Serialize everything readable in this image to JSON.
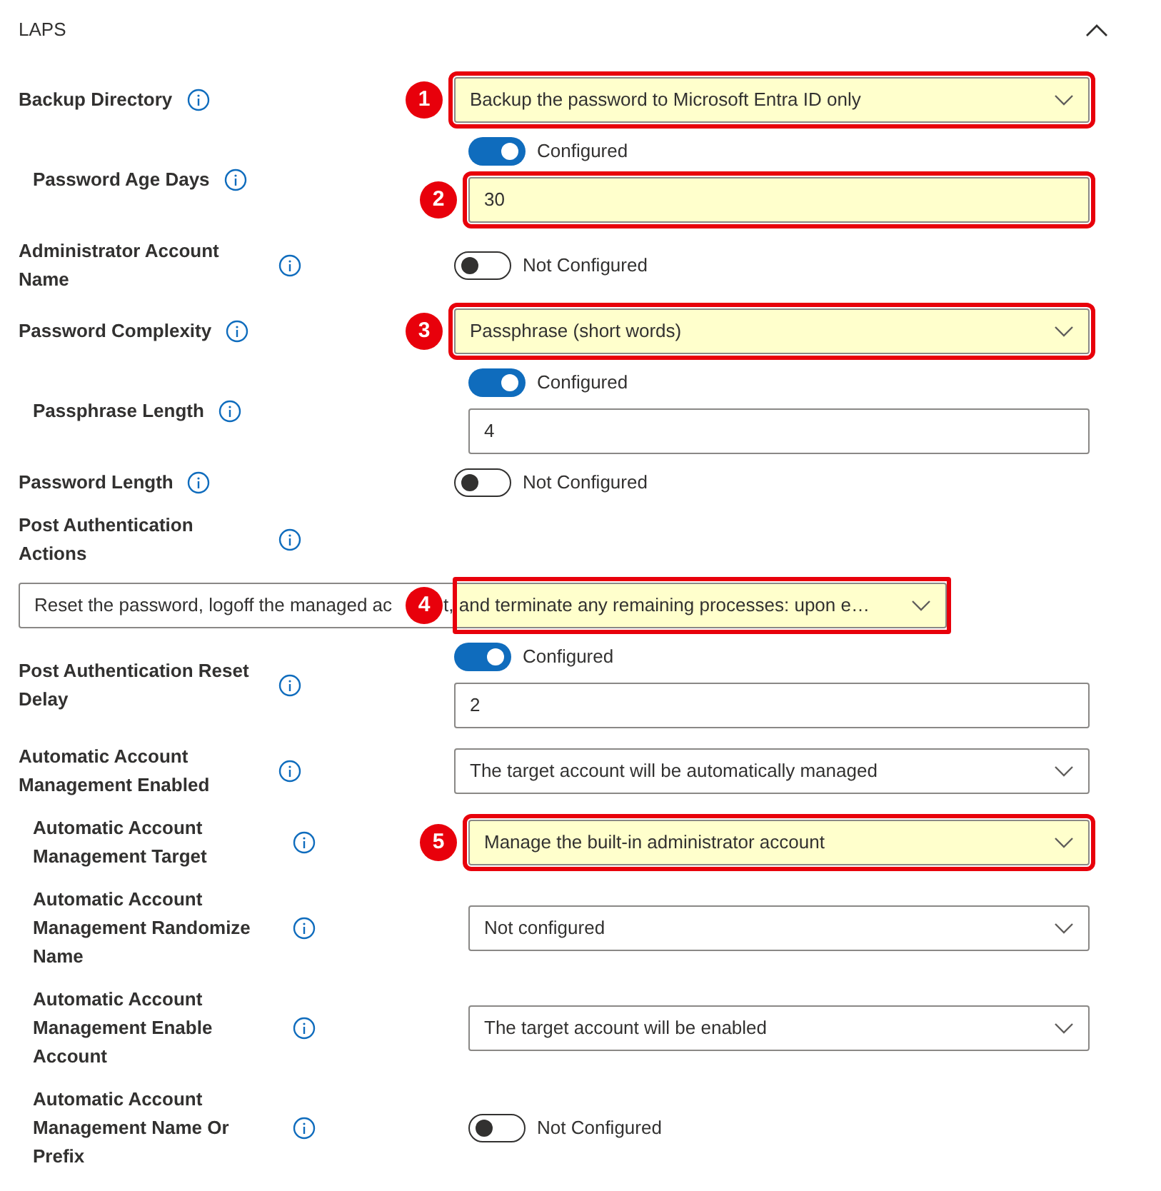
{
  "section": {
    "title": "LAPS",
    "expanded": true
  },
  "settings": [
    {
      "label": "Backup Directory",
      "controls": [
        {
          "kind": "dropdown",
          "value": "Backup the password to Microsoft Entra ID only",
          "callout": "1"
        }
      ],
      "children": [
        {
          "label": "Password Age Days",
          "controls": [
            {
              "kind": "toggle",
              "on": true,
              "text": "Configured"
            },
            {
              "kind": "textbox",
              "value": "30",
              "callout": "2"
            }
          ]
        }
      ]
    },
    {
      "label": "Administrator Account Name",
      "controls": [
        {
          "kind": "toggle",
          "on": false,
          "text": "Not Configured"
        }
      ]
    },
    {
      "label": "Password Complexity",
      "controls": [
        {
          "kind": "dropdown",
          "value": "Passphrase (short words)",
          "callout": "3"
        }
      ],
      "children": [
        {
          "label": "Passphrase Length",
          "controls": [
            {
              "kind": "toggle",
              "on": true,
              "text": "Configured"
            },
            {
              "kind": "textbox",
              "value": "4"
            }
          ]
        }
      ]
    },
    {
      "label": "Password Length",
      "controls": [
        {
          "kind": "toggle",
          "on": false,
          "text": "Not Configured"
        }
      ]
    },
    {
      "label": "Post Authentication Actions",
      "controls": [
        {
          "kind": "wide_dropdown",
          "value_parts": [
            "Reset the password, logoff the managed ac",
            "t, and terminate any remaining processes: upon e…"
          ],
          "callout": "4"
        }
      ]
    },
    {
      "label": "Post Authentication Reset Delay",
      "controls": [
        {
          "kind": "toggle",
          "on": true,
          "text": "Configured"
        },
        {
          "kind": "textbox",
          "value": "2"
        }
      ]
    },
    {
      "label": "Automatic Account Management Enabled",
      "controls": [
        {
          "kind": "dropdown",
          "value": "The target account will be automatically managed"
        }
      ],
      "children": [
        {
          "label": "Automatic Account Management Target",
          "controls": [
            {
              "kind": "dropdown",
              "value": "Manage the built-in administrator account",
              "callout": "5"
            }
          ]
        },
        {
          "label": "Automatic Account Management Randomize Name",
          "controls": [
            {
              "kind": "dropdown",
              "value": "Not configured"
            }
          ]
        },
        {
          "label": "Automatic Account Management Enable Account",
          "controls": [
            {
              "kind": "dropdown",
              "value": "The target account will be enabled"
            }
          ]
        },
        {
          "label": "Automatic Account Management Name Or Prefix",
          "controls": [
            {
              "kind": "toggle",
              "on": false,
              "text": "Not Configured"
            }
          ]
        }
      ]
    }
  ]
}
